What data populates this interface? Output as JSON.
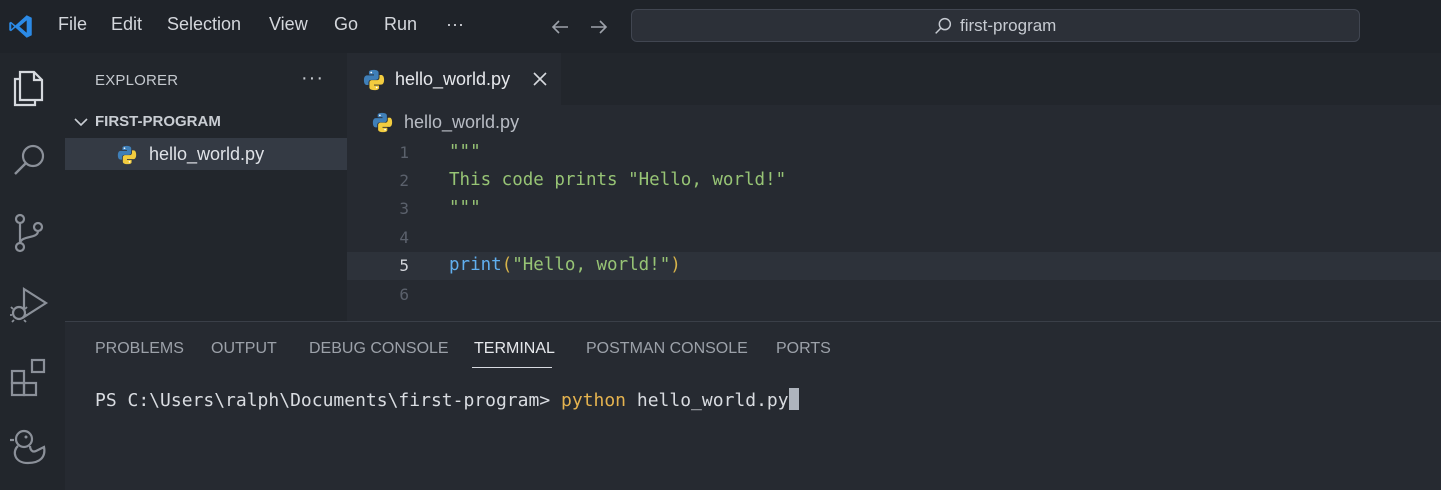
{
  "titlebar": {
    "menu": [
      "File",
      "Edit",
      "Selection",
      "View",
      "Go",
      "Run",
      "···"
    ],
    "search_text": "first-program"
  },
  "activity_icons": [
    "files-icon",
    "search-icon",
    "source-control-icon",
    "run-debug-icon",
    "extensions-icon",
    "duck-icon"
  ],
  "sidebar": {
    "title": "EXPLORER",
    "more": "···",
    "folder": "FIRST-PROGRAM",
    "file": "hello_world.py"
  },
  "tab": {
    "label": "hello_world.py"
  },
  "breadcrumb": {
    "label": "hello_world.py"
  },
  "editor": {
    "current_line": 5,
    "lines": [
      {
        "num": "1",
        "text": "\"\"\""
      },
      {
        "num": "2",
        "text": "This code prints \"Hello, world!\""
      },
      {
        "num": "3",
        "text": "\"\"\""
      },
      {
        "num": "4",
        "text": ""
      },
      {
        "num": "5",
        "func": "print",
        "open": "(",
        "arg": "\"Hello, world!\"",
        "close": ")"
      },
      {
        "num": "6",
        "text": ""
      }
    ]
  },
  "panel": {
    "tabs": [
      "PROBLEMS",
      "OUTPUT",
      "DEBUG CONSOLE",
      "TERMINAL",
      "POSTMAN CONSOLE",
      "PORTS"
    ],
    "active_tab": "TERMINAL",
    "terminal": {
      "prompt": "PS C:\\Users\\ralph\\Documents\\first-program> ",
      "command": "python",
      "args": " hello_world.py"
    }
  },
  "colors": {
    "accent_blue": "#2b8ae6",
    "string_green": "#97c475",
    "function_blue": "#61afef",
    "command_yellow": "#e5b34f"
  }
}
